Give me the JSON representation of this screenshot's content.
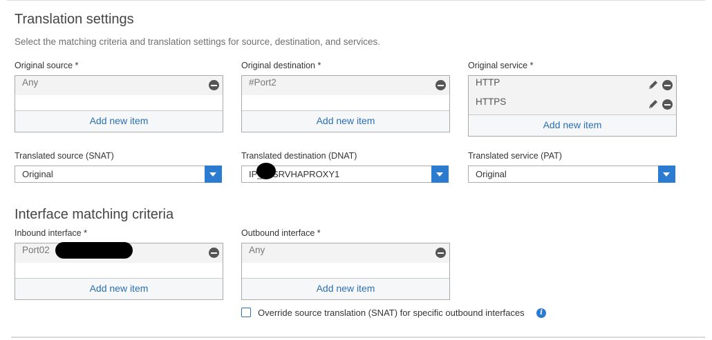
{
  "translation": {
    "title": "Translation settings",
    "subtitle": "Select the matching criteria and translation settings for source, destination, and services.",
    "original_source": {
      "label": "Original source *",
      "items": [
        "Any"
      ],
      "add_label": "Add new item"
    },
    "original_destination": {
      "label": "Original destination *",
      "items": [
        "#Port2"
      ],
      "add_label": "Add new item"
    },
    "original_service": {
      "label": "Original service *",
      "items": [
        "HTTP",
        "HTTPS"
      ],
      "add_label": "Add new item"
    },
    "translated_source": {
      "label": "Translated source (SNAT)",
      "value": "Original"
    },
    "translated_destination": {
      "label": "Translated destination (DNAT)",
      "value": "IP_    SRVHAPROXY1"
    },
    "translated_service": {
      "label": "Translated service (PAT)",
      "value": "Original"
    }
  },
  "interface": {
    "title": "Interface matching criteria",
    "inbound": {
      "label": "Inbound interface *",
      "items": [
        "Port02"
      ],
      "add_label": "Add new item"
    },
    "outbound": {
      "label": "Outbound interface *",
      "items": [
        "Any"
      ],
      "add_label": "Add new item"
    },
    "override_label": "Override source translation (SNAT) for specific outbound interfaces"
  },
  "icons": {
    "remove": "minus-circle-icon",
    "edit": "pencil-icon",
    "dropdown": "chevron-down-icon",
    "info": "info-icon"
  },
  "colors": {
    "accent": "#2b7bd0",
    "link": "#2b6fb3",
    "redaction": "#000000"
  }
}
